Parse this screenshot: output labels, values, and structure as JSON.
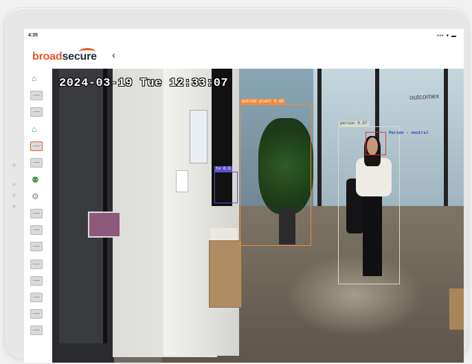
{
  "device": {
    "status_time": "4:35",
    "status_icons": "••• ▾ ▬"
  },
  "app": {
    "logo_part1": "broad",
    "logo_part2": "secure",
    "back_glyph": "‹"
  },
  "sidebar": {
    "items": [
      {
        "icon": "camera-icon",
        "glyph": "⌂"
      },
      {
        "icon": "thumbnail-icon"
      },
      {
        "icon": "thumbnail-icon"
      },
      {
        "icon": "camera-icon",
        "glyph": "⌂"
      },
      {
        "icon": "thumbnail-icon",
        "selected": true
      },
      {
        "icon": "thumbnail-icon"
      },
      {
        "icon": "camera-group-icon",
        "glyph": "⚉"
      },
      {
        "icon": "gear-icon",
        "glyph": "⚙"
      },
      {
        "icon": "thumbnail-icon"
      },
      {
        "icon": "thumbnail-icon"
      },
      {
        "icon": "thumbnail-icon"
      },
      {
        "icon": "thumbnail-icon"
      },
      {
        "icon": "thumbnail-icon"
      },
      {
        "icon": "thumbnail-icon"
      },
      {
        "icon": "thumbnail-icon"
      },
      {
        "icon": "thumbnail-icon"
      }
    ]
  },
  "feed": {
    "timestamp": "2024-03-19 Tue 12:33:07",
    "window_text": "outcomex",
    "detections": [
      {
        "label": "potted plant 0.65",
        "color": "#f08c3a"
      },
      {
        "label": "person 0.87",
        "color": "#d8dccf"
      },
      {
        "label": "Person - neutral",
        "color": "#3a3ab8"
      },
      {
        "label": "tv 0.5",
        "color": "#5a52c8"
      }
    ]
  },
  "colors": {
    "accent": "#e4572e",
    "brand_dark": "#1d2b3a"
  }
}
